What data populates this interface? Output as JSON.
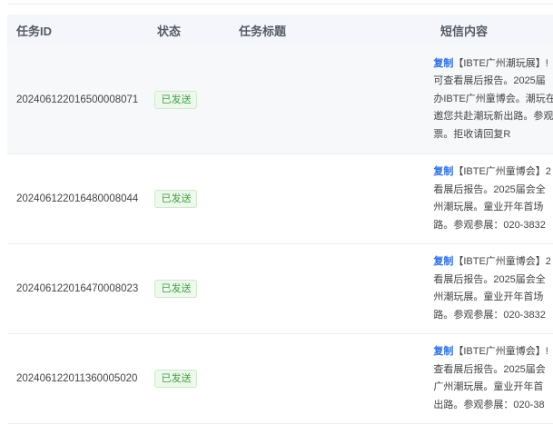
{
  "table": {
    "headers": {
      "id": "任务ID",
      "status": "状态",
      "title": "任务标题",
      "sms": "短信内容"
    },
    "copy_label": "复制",
    "rows": [
      {
        "id": "20240612201650000807  1",
        "status": "已发送",
        "title": "",
        "sms_lines": [
          "【IBTE广州潮玩展】!",
          "可查看展后报告。2025届",
          "办IBTE广州童博会。潮玩在",
          "邀您共赴潮玩新出路。参观",
          "票。拒收请回复R"
        ]
      },
      {
        "id": "20240612201648000804 4",
        "status": "已发送",
        "title": "",
        "sms_lines": [
          "【IBTE广州童博会】2",
          "看展后报告。2025届会全",
          "州潮玩展。童业开年首场",
          "路。参观参展：020-3832"
        ]
      },
      {
        "id": "20240612201647000802 3",
        "status": "已发送",
        "title": "",
        "sms_lines": [
          "【IBTE广州童博会】2",
          "看展后报告。2025届会全",
          "州潮玩展。童业开年首场",
          "路。参观参展：020-3832"
        ]
      },
      {
        "id": "20240612201136000502 0",
        "status": "已发送",
        "title": "",
        "sms_lines": [
          "【IBTE广州童博会】!",
          "查看展后报告。2025届会",
          "广州潮玩展。童业开年首",
          "出路。参观参展：020-38"
        ]
      }
    ]
  }
}
